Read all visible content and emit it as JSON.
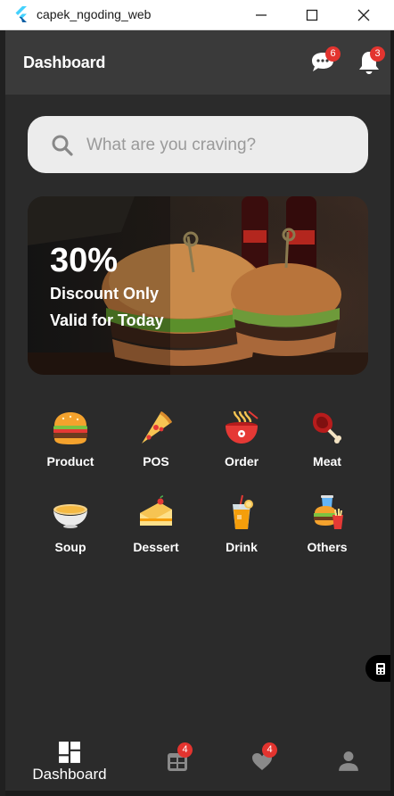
{
  "window": {
    "title": "capek_ngoding_web"
  },
  "appbar": {
    "title": "Dashboard",
    "chat_badge": "6",
    "notification_badge": "3"
  },
  "search": {
    "placeholder": "What are you craving?"
  },
  "banner": {
    "percent": "30%",
    "line1": "Discount Only",
    "line2": "Valid for Today"
  },
  "categories": [
    {
      "label": "Product",
      "icon": "burger-icon"
    },
    {
      "label": "POS",
      "icon": "pizza-icon"
    },
    {
      "label": "Order",
      "icon": "noodle-bowl-icon"
    },
    {
      "label": "Meat",
      "icon": "meat-icon"
    },
    {
      "label": "Soup",
      "icon": "soup-icon"
    },
    {
      "label": "Dessert",
      "icon": "cake-icon"
    },
    {
      "label": "Drink",
      "icon": "drink-icon"
    },
    {
      "label": "Others",
      "icon": "fast-food-icon"
    }
  ],
  "bottom_nav": {
    "dashboard_label": "Dashboard",
    "orders_badge": "4",
    "favorites_badge": "4"
  },
  "colors": {
    "appbar": "#3a3a3a",
    "background": "#2b2b2b",
    "badge": "#e3342f",
    "search_bg": "#ececec"
  }
}
